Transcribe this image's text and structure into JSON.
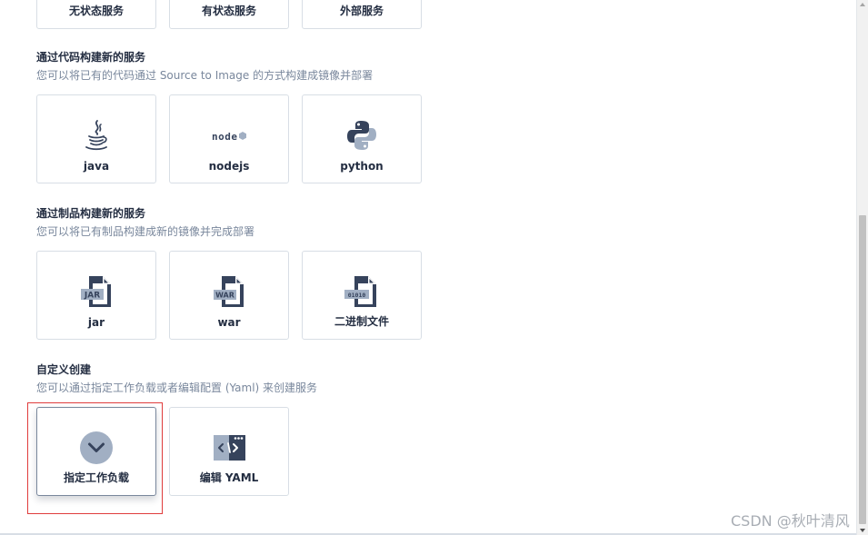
{
  "top_row": {
    "cards": [
      {
        "label": "无状态服务"
      },
      {
        "label": "有状态服务"
      },
      {
        "label": "外部服务"
      }
    ]
  },
  "code_section": {
    "title": "通过代码构建新的服务",
    "description": "您可以将已有的代码通过 Source to Image 的方式构建成镜像并部署",
    "cards": [
      {
        "label": "java",
        "icon": "java-icon"
      },
      {
        "label": "nodejs",
        "icon": "nodejs-icon",
        "logo_text": "node"
      },
      {
        "label": "python",
        "icon": "python-icon"
      }
    ]
  },
  "artifact_section": {
    "title": "通过制品构建新的服务",
    "description": "您可以将已有制品构建成新的镜像并完成部署",
    "cards": [
      {
        "label": "jar",
        "icon": "jar-file-icon",
        "badge": "JAR"
      },
      {
        "label": "war",
        "icon": "war-file-icon",
        "badge": "WAR"
      },
      {
        "label": "二进制文件",
        "icon": "binary-file-icon",
        "badge": "01010"
      }
    ]
  },
  "custom_section": {
    "title": "自定义创建",
    "description": "您可以通过指定工作负载或者编辑配置 (Yaml) 来创建服务",
    "cards": [
      {
        "label": "指定工作负载",
        "icon": "chevron-down-circle-icon",
        "selected": true
      },
      {
        "label": "编辑 YAML",
        "icon": "code-editor-icon"
      }
    ]
  },
  "watermark": {
    "text": "CSDN @秋叶清风"
  },
  "colors": {
    "text_primary": "#242e42",
    "text_secondary": "#79879c",
    "border": "#d8dee5",
    "highlight": "#e03c3c",
    "icon_gray": "#a1afc3",
    "icon_dark": "#36435c"
  }
}
